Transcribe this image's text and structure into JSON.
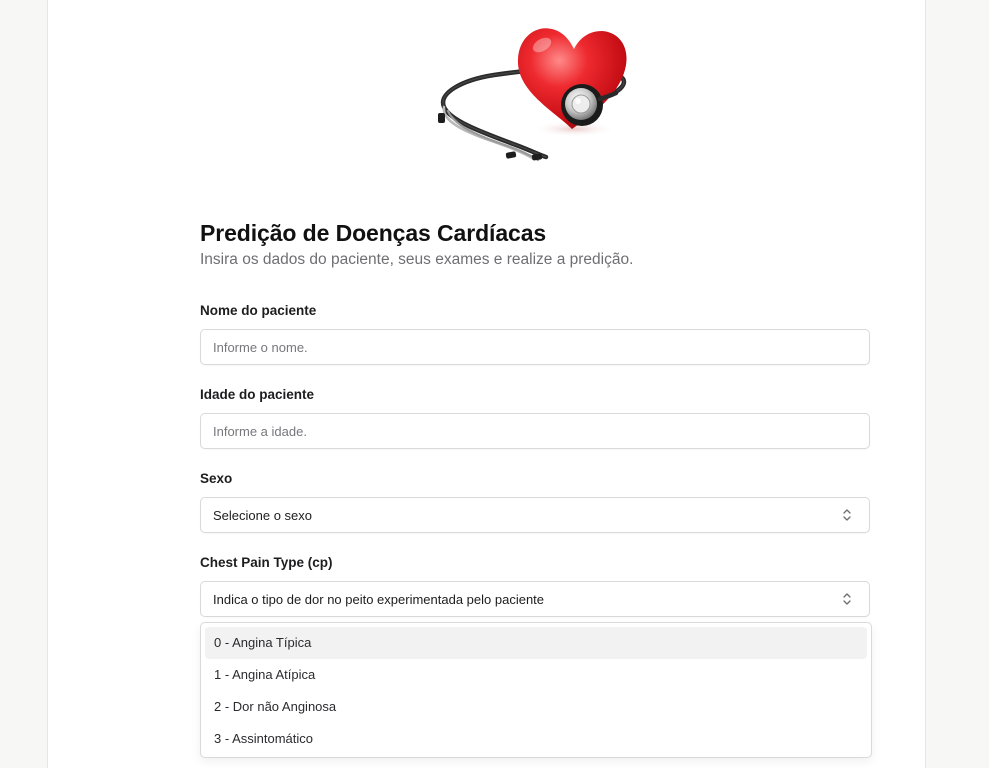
{
  "hero": {
    "icon": "heart-stethoscope-illustration"
  },
  "header": {
    "title": "Predição de Doenças Cardíacas",
    "subtitle": "Insira os dados do paciente, seus exames e realize a predição."
  },
  "form": {
    "name": {
      "label": "Nome do paciente",
      "placeholder": "Informe o nome.",
      "value": ""
    },
    "age": {
      "label": "Idade do paciente",
      "placeholder": "Informe a idade.",
      "value": ""
    },
    "sex": {
      "label": "Sexo",
      "selected": "Selecione o sexo"
    },
    "cp": {
      "label": "Chest Pain Type (cp)",
      "selected": "Indica o tipo de dor no peito experimentada pelo paciente",
      "options": [
        "0 - Angina Típica",
        "1 - Angina Atípica",
        "2 - Dor não Anginosa",
        "3 - Assintomático"
      ],
      "highlighted_option": "0 - Angina Típica"
    }
  },
  "colors": {
    "page_background": "#f7f7f6",
    "card_background": "#ffffff",
    "border": "#d9d9dc",
    "heart_red": "#e3141d",
    "option_highlight": "#f2f2f3"
  }
}
